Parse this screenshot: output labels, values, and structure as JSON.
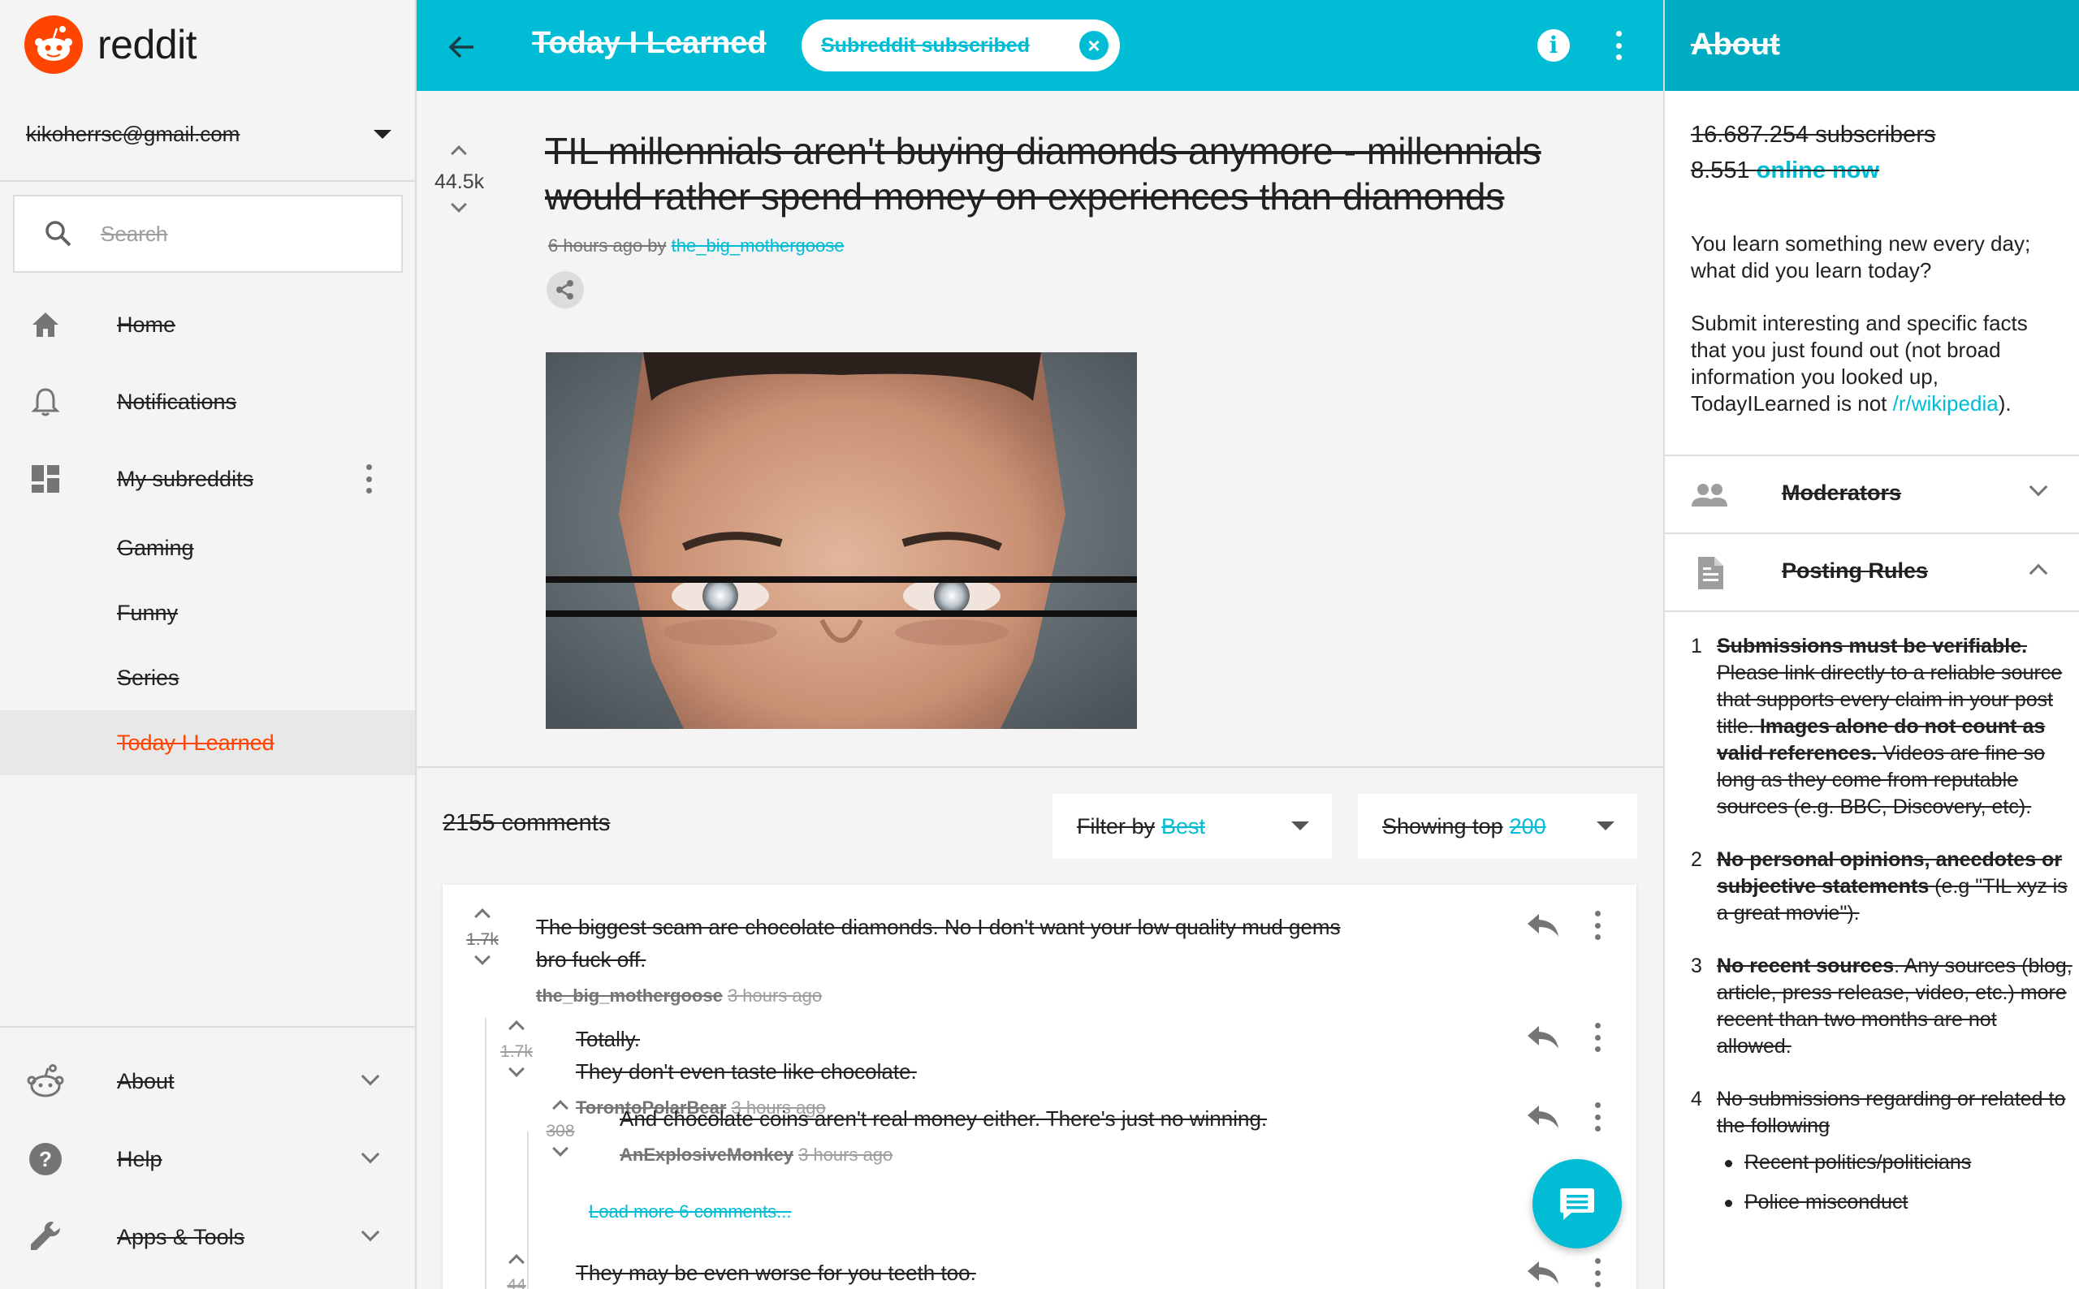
{
  "app": {
    "logo_text": "reddit"
  },
  "sidebar": {
    "account": "kikoherrsc@gmail.com",
    "search_placeholder": "Search",
    "nav": [
      {
        "label": "Home",
        "icon": "home-icon"
      },
      {
        "label": "Notifications",
        "icon": "bell-icon"
      },
      {
        "label": "My subreddits",
        "icon": "dashboard-icon"
      }
    ],
    "subreddits": [
      "Gaming",
      "Funny",
      "Series",
      "Today I Learned"
    ],
    "active_subreddit": "Today I Learned",
    "footer": [
      {
        "label": "About",
        "icon": "reddit-alien-icon"
      },
      {
        "label": "Help",
        "icon": "help-icon"
      },
      {
        "label": "Apps & Tools",
        "icon": "wrench-icon"
      }
    ]
  },
  "topbar": {
    "title": "Today I Learned",
    "chip_label": "Subreddit subscribed"
  },
  "post": {
    "score": "44.5k",
    "title": "TIL millennials aren't buying diamonds anymore - millennials would rather spend money on experiences than diamonds",
    "time": "6 hours ago by",
    "author": "the_big_mothergoose"
  },
  "comments_bar": {
    "count": "2155 comments",
    "filter_prefix": "Filter by",
    "filter_value": "Best",
    "showing_prefix": "Showing top",
    "showing_value": "200"
  },
  "comments": [
    {
      "score": "1.7k",
      "text": "The biggest scam are chocolate diamonds. No I don't want your low quality mud gems bro fuck off.",
      "user": "the_big_mothergoose",
      "time": "3 hours ago"
    },
    {
      "score": "1.7k",
      "text_line1": "Totally.",
      "text_line2": "They don't even taste like chocolate.",
      "user": "TorontoPolarBear",
      "time": "3 hours ago"
    },
    {
      "score": "308",
      "text": "And chocolate coins aren't real money either. There's just no winning.",
      "user": "AnExplosiveMonkey",
      "time": "3 hours ago"
    },
    {
      "load_more": "Load more 6 comments..."
    },
    {
      "score": "44",
      "text": "They may be even worse for you teeth too."
    }
  ],
  "about": {
    "title": "About",
    "subscribers": "16.687.254 subscribers",
    "online_count": "8.551",
    "online_label": "online now",
    "desc1": "You learn something new every day; what did you learn today?",
    "desc2_a": "Submit interesting and specific facts that you just found out (not broad information you looked up, TodayILearned is not",
    "desc2_link": "/r/wikipedia",
    "desc2_b": ").",
    "moderators": "Moderators",
    "posting_rules": "Posting Rules",
    "rules": [
      {
        "num": "1",
        "bold": "Submissions must be verifiable.",
        "text": "Please link directly to a reliable source that supports every claim in your post title.",
        "bold2": "Images alone do not count as valid references.",
        "text2": "Videos are fine so long as they come from reputable sources (e.g. BBC, Discovery, etc)."
      },
      {
        "num": "2",
        "bold": "No personal opinions, anecdotes or subjective statements",
        "text": "(e.g \"TIL xyz is a great movie\")."
      },
      {
        "num": "3",
        "bold": "No recent sources",
        "text": ". Any sources (blog, article, press release, video, etc.) more recent than two months are not allowed."
      },
      {
        "num": "4",
        "text": "No submissions regarding or related to the following"
      }
    ],
    "rule4_bullets": [
      "Recent politics/politicians",
      "Police misconduct"
    ]
  },
  "colors": {
    "accent": "#00bcd4",
    "brand": "#ff4500",
    "about_header": "#00acc1"
  }
}
